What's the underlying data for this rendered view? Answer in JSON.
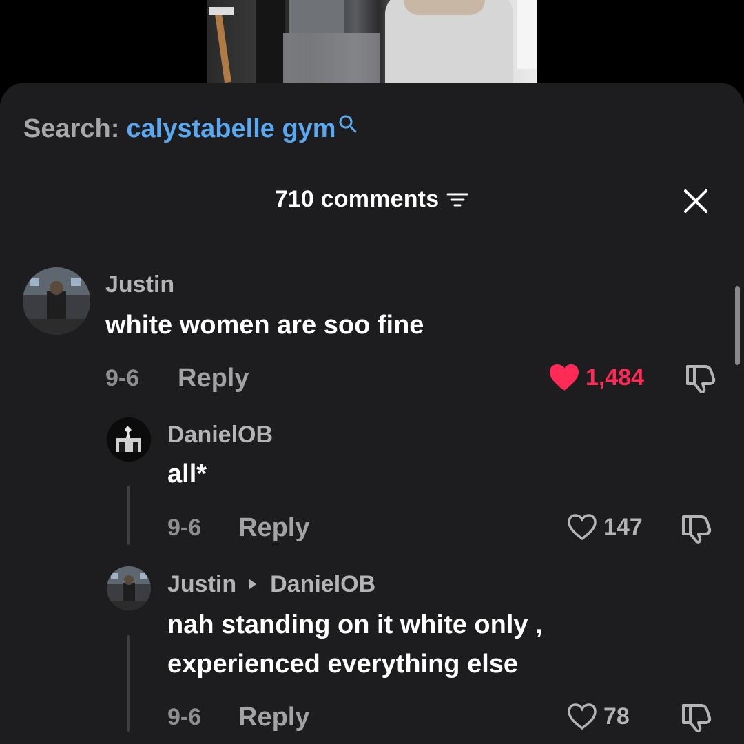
{
  "search": {
    "prefix": "Search:",
    "term": "calystabelle gym"
  },
  "comments_panel": {
    "count_label": "710 comments"
  },
  "comments": [
    {
      "username": "Justin",
      "text": "white women are soo fine",
      "date": "9-6",
      "reply_label": "Reply",
      "likes": "1,484",
      "liked": true
    },
    {
      "username": "DanielOB",
      "text": "all*",
      "date": "9-6",
      "reply_label": "Reply",
      "likes": "147",
      "liked": false
    },
    {
      "username": "Justin",
      "reply_to": "DanielOB",
      "text_line1": "nah standing on it white only ,",
      "text_line2": "experienced everything else",
      "date": "9-6",
      "reply_label": "Reply",
      "likes": "78",
      "liked": false
    }
  ],
  "colors": {
    "sheet_bg": "#1d1d1f",
    "search_link": "#5aa9f0",
    "liked_heart": "#ff2a55"
  },
  "icons": [
    "search-icon",
    "filter-icon",
    "close-icon",
    "heart-filled-icon",
    "heart-outline-icon",
    "dislike-icon",
    "reply-arrow-icon"
  ]
}
